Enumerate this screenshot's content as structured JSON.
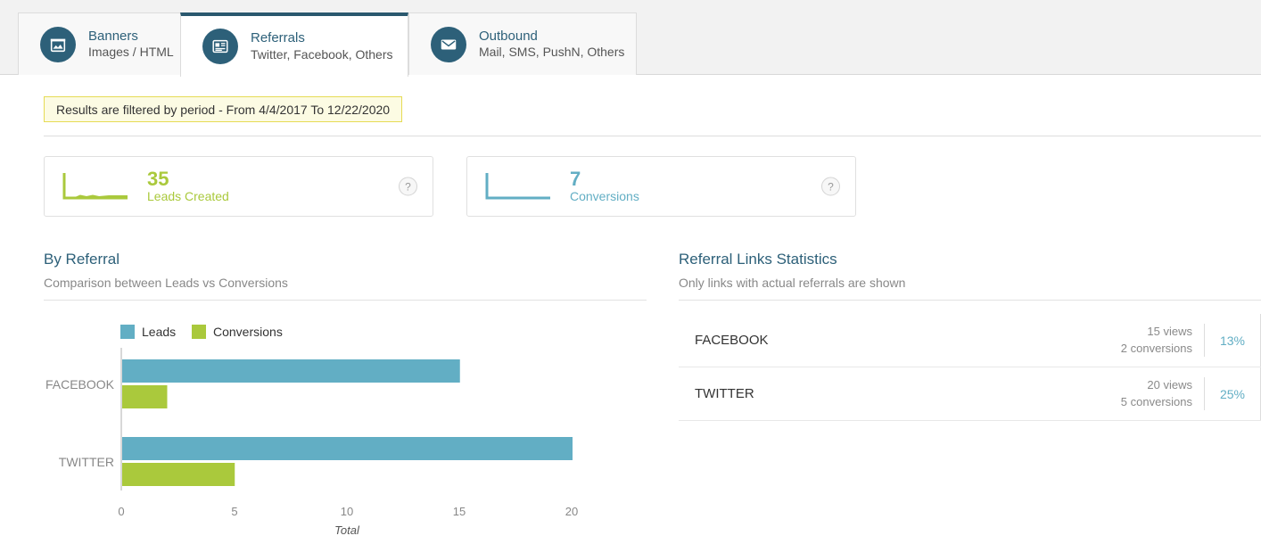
{
  "tabs": [
    {
      "title": "Banners",
      "subtitle": "Images / HTML",
      "icon": "banner-icon",
      "active": false
    },
    {
      "title": "Referrals",
      "subtitle": "Twitter, Facebook, Others",
      "icon": "article-icon",
      "active": true
    },
    {
      "title": "Outbound",
      "subtitle": "Mail, SMS, PushN, Others",
      "icon": "envelope-icon",
      "active": false
    }
  ],
  "filter_notice": "Results are filtered by period - From 4/4/2017 To 12/22/2020",
  "kpis": [
    {
      "value": "35",
      "label": "Leads Created",
      "color": "#aac93c",
      "help": "?"
    },
    {
      "value": "7",
      "label": "Conversions",
      "color": "#62aec4",
      "help": "?"
    }
  ],
  "left_panel": {
    "title": "By Referral",
    "subtitle": "Comparison between Leads vs Conversions"
  },
  "right_panel": {
    "title": "Referral Links Statistics",
    "subtitle": "Only links with actual referrals are shown",
    "rows": [
      {
        "name": "FACEBOOK",
        "views": "15 views",
        "conversions": "2 conversions",
        "percent": "13%"
      },
      {
        "name": "TWITTER",
        "views": "20 views",
        "conversions": "5 conversions",
        "percent": "25%"
      }
    ]
  },
  "chart_data": {
    "type": "bar",
    "orientation": "horizontal",
    "title": "By Referral",
    "subtitle": "Comparison between Leads vs Conversions",
    "categories": [
      "FACEBOOK",
      "TWITTER"
    ],
    "series": [
      {
        "name": "Leads",
        "values": [
          15,
          20
        ],
        "color": "#62aec4"
      },
      {
        "name": "Conversions",
        "values": [
          2,
          5
        ],
        "color": "#aac93c"
      }
    ],
    "xlabel": "Total",
    "ylabel": "",
    "xticks": [
      0,
      5,
      10,
      15,
      20
    ],
    "xlim": [
      0,
      20
    ],
    "grid": false,
    "legend": [
      "Leads",
      "Conversions"
    ],
    "legend_position": "top-left"
  },
  "colors": {
    "leads": "#62aec4",
    "conversions": "#aac93c",
    "brand_dark": "#2d6079",
    "notice_bg": "#fcfbe3",
    "notice_border": "#e6db55"
  }
}
